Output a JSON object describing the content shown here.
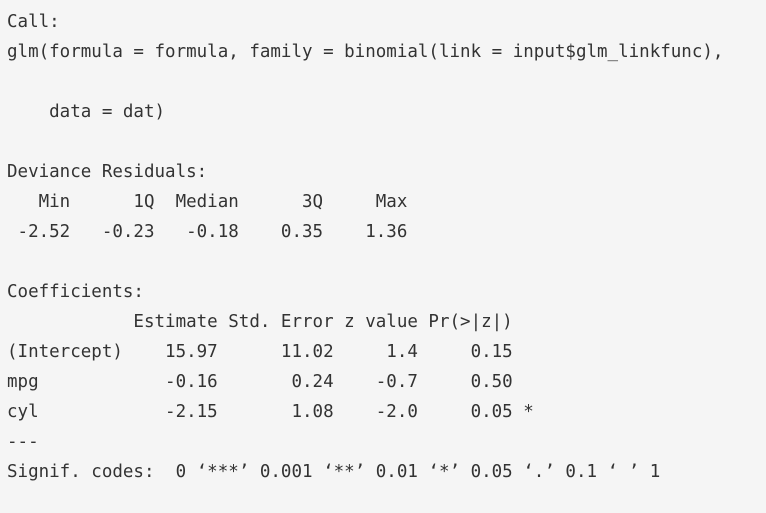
{
  "output": {
    "lines": [
      "Call:",
      "glm(formula = formula, family = binomial(link = input$glm_linkfunc),",
      "",
      "    data = dat)",
      "",
      "Deviance Residuals:",
      "   Min      1Q  Median      3Q     Max",
      " -2.52   -0.23   -0.18    0.35    1.36",
      "",
      "Coefficients:",
      "            Estimate Std. Error z value Pr(>|z|)",
      "(Intercept)    15.97      11.02     1.4     0.15",
      "mpg            -0.16       0.24    -0.7     0.50",
      "cyl            -2.15       1.08    -2.0     0.05 *",
      "---",
      "Signif. codes:  0 ‘***’ 0.001 ‘**’ 0.01 ‘*’ 0.05 ‘.’ 0.1 ‘ ’ 1"
    ]
  }
}
